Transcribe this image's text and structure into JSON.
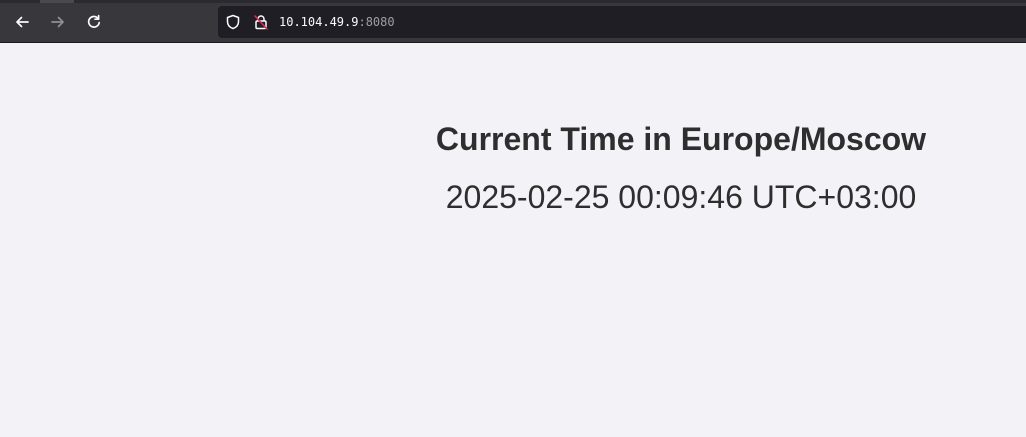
{
  "browser": {
    "url_host": "10.104.49.9",
    "url_port": ":8080",
    "icons": {
      "back": "arrow-left-icon",
      "forward": "arrow-right-icon",
      "reload": "reload-icon",
      "tracking": "shield-icon",
      "security": "insecure-lock-icon"
    }
  },
  "page": {
    "heading": "Current Time in Europe/Moscow",
    "time": "2025-02-25 00:09:46 UTC+03:00"
  },
  "colors": {
    "toolbar": "#38373c",
    "urlbar": "#1f1e25",
    "page_background": "#f3f2f7",
    "text": "#2e2e2e",
    "insecure_accent": "#e22850"
  }
}
